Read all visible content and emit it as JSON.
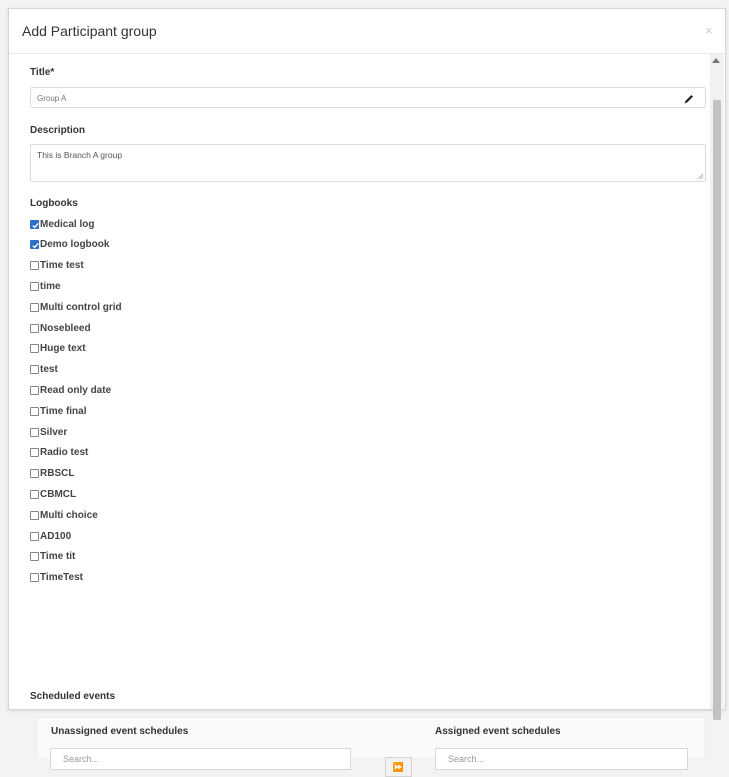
{
  "modal": {
    "title": "Add Participant group",
    "close_glyph": "×"
  },
  "form": {
    "title_label": "Title*",
    "title_value": "Group A",
    "description_label": "Description",
    "description_value": "This is Branch A group",
    "logbooks_label": "Logbooks",
    "logbooks": [
      {
        "label": "Medical log",
        "checked": true
      },
      {
        "label": "Demo logbook",
        "checked": true
      },
      {
        "label": "Time test",
        "checked": false
      },
      {
        "label": "time",
        "checked": false
      },
      {
        "label": "Multi control grid",
        "checked": false
      },
      {
        "label": "Nosebleed",
        "checked": false
      },
      {
        "label": "Huge text",
        "checked": false
      },
      {
        "label": "test",
        "checked": false
      },
      {
        "label": "Read only date",
        "checked": false
      },
      {
        "label": "Time final",
        "checked": false
      },
      {
        "label": "Silver",
        "checked": false
      },
      {
        "label": "Radio test",
        "checked": false
      },
      {
        "label": "RBSCL",
        "checked": false
      },
      {
        "label": "CBMCL",
        "checked": false
      },
      {
        "label": "Multi choice",
        "checked": false
      },
      {
        "label": "AD100",
        "checked": false
      },
      {
        "label": "Time tit",
        "checked": false
      },
      {
        "label": "TimeTest",
        "checked": false
      }
    ],
    "scheduled_events_label": "Scheduled events",
    "unassigned_label": "Unassigned event schedules",
    "assigned_label": "Assigned event schedules",
    "unassigned_search_placeholder": "Search...",
    "assigned_search_placeholder": "Search...",
    "move_all_glyph": "⏩"
  },
  "colors": {
    "checkbox_checked": "#2b6fc8",
    "border": "#dcdcdc"
  },
  "icons": {
    "edit": "pencil-icon",
    "close": "close-icon",
    "move": "double-arrow-right-icon"
  }
}
